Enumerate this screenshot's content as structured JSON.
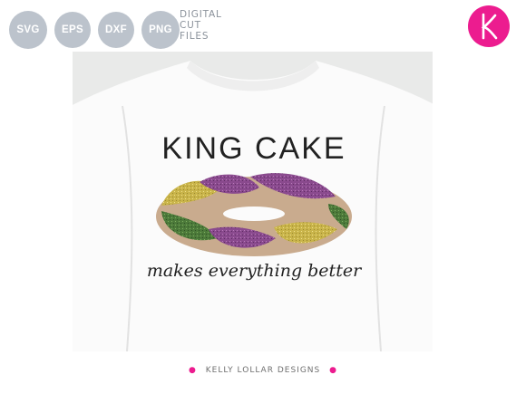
{
  "formats": [
    "SVG",
    "EPS",
    "DXF",
    "PNG"
  ],
  "cut_files_label": [
    "DIGITAL",
    "CUT",
    "FILES"
  ],
  "brand_logo_letter": "K",
  "design": {
    "title": "KING CAKE",
    "tagline": "makes everything better"
  },
  "footer": "KELLY LOLLAR DESIGNS",
  "colors": {
    "format_badge": "#bcc3cc",
    "brand_pink": "#ec1c8f",
    "glitter_purple": "#8a4a8e",
    "glitter_gold": "#c9b44a",
    "glitter_green": "#4c7a3a",
    "cake_dough": "#c9ab8e"
  }
}
